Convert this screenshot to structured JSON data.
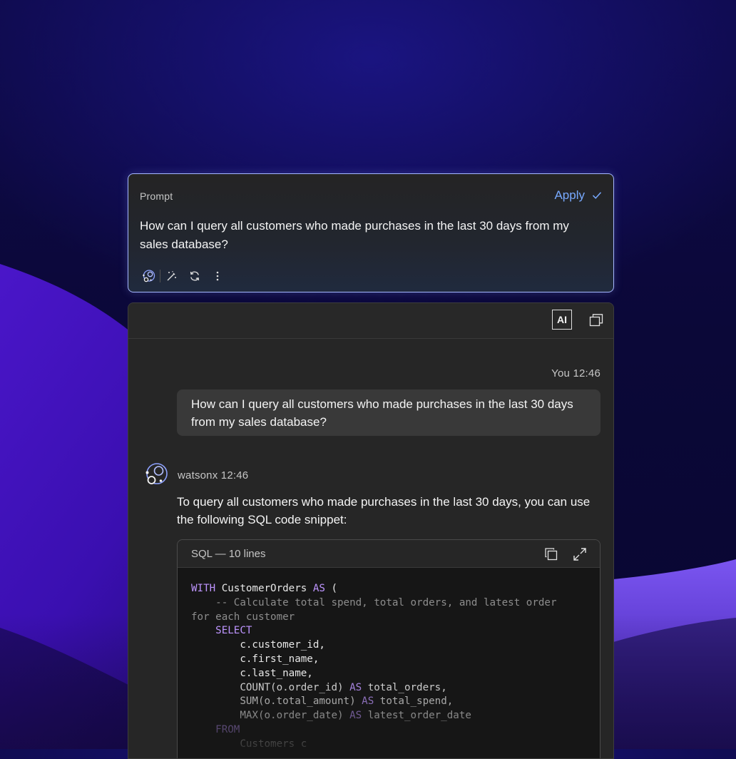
{
  "prompt": {
    "label": "Prompt",
    "apply_label": "Apply",
    "text": "How can I query all customers who made purchases in the last 30 days from my sales database?",
    "toolbar_icons": [
      "watsonx-icon",
      "magic-wand-icon",
      "refresh-icon",
      "overflow-menu-icon"
    ]
  },
  "chat": {
    "header": {
      "ai_badge": "AI"
    },
    "user_message": {
      "meta": "You 12:46",
      "text": "How can I query all customers who made purchases in the last 30 days from my sales database?"
    },
    "bot_message": {
      "meta": "watsonx 12:46",
      "text": "To query all customers who made purchases in the last 30 days, you can use the following SQL code snippet:",
      "code": {
        "title": "SQL — 10 lines",
        "lines": [
          "WITH CustomerOrders AS (",
          "    -- Calculate total spend, total orders, and latest order",
          "for each customer",
          "    SELECT",
          "        c.customer_id,",
          "        c.first_name,",
          "        c.last_name,",
          "        COUNT(o.order_id) AS total_orders,",
          "        SUM(o.total_amount) AS total_spend,",
          "        MAX(o.order_date) AS latest_order_date",
          "    FROM",
          "        Customers c"
        ]
      }
    }
  },
  "colors": {
    "accent": "#78a9ff",
    "keyword": "#be95ff",
    "focus_border": "#a6b7ff",
    "background": "#0b0838"
  }
}
